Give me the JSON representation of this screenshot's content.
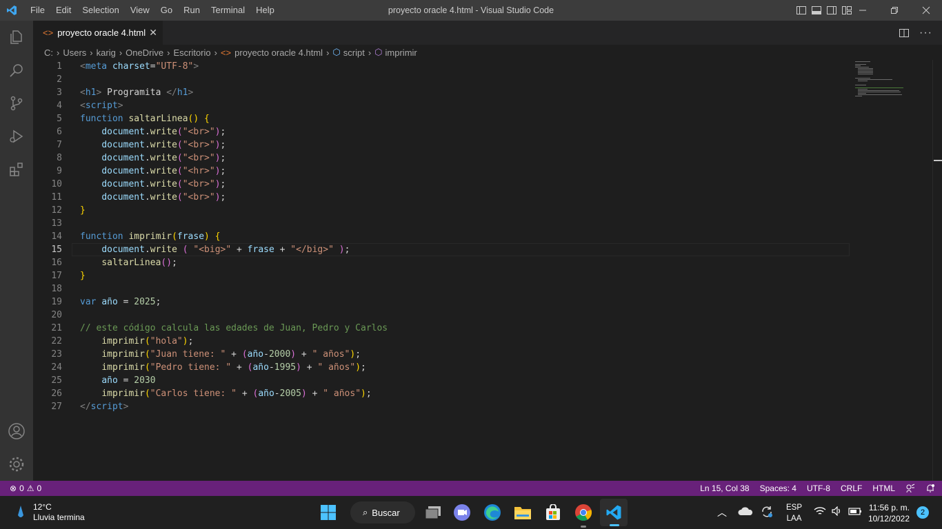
{
  "window": {
    "title": "proyecto oracle 4.html - Visual Studio Code",
    "menu": [
      "File",
      "Edit",
      "Selection",
      "View",
      "Go",
      "Run",
      "Terminal",
      "Help"
    ]
  },
  "tab": {
    "label": "proyecto oracle 4.html"
  },
  "breadcrumb": [
    "C:",
    "Users",
    "karig",
    "OneDrive",
    "Escritorio",
    "proyecto oracle 4.html",
    "script",
    "imprimir"
  ],
  "editor": {
    "current_line": 15,
    "lines": [
      {
        "n": "1"
      },
      {
        "n": "2"
      },
      {
        "n": "3"
      },
      {
        "n": "4"
      },
      {
        "n": "5"
      },
      {
        "n": "6"
      },
      {
        "n": "7"
      },
      {
        "n": "8"
      },
      {
        "n": "9"
      },
      {
        "n": "10"
      },
      {
        "n": "11"
      },
      {
        "n": "12"
      },
      {
        "n": "13"
      },
      {
        "n": "14"
      },
      {
        "n": "15"
      },
      {
        "n": "16"
      },
      {
        "n": "17"
      },
      {
        "n": "18"
      },
      {
        "n": "19"
      },
      {
        "n": "20"
      },
      {
        "n": "21"
      },
      {
        "n": "22"
      },
      {
        "n": "23"
      },
      {
        "n": "24"
      },
      {
        "n": "25"
      },
      {
        "n": "26"
      },
      {
        "n": "27"
      }
    ],
    "code": [
      [
        [
          "tp",
          "<"
        ],
        [
          "tag",
          "meta"
        ],
        [
          "tx",
          " "
        ],
        [
          "attr",
          "charset"
        ],
        [
          "tx",
          "="
        ],
        [
          "str",
          "\"UTF-8\""
        ],
        [
          "tp",
          ">"
        ]
      ],
      [],
      [
        [
          "tp",
          "<"
        ],
        [
          "tag",
          "h1"
        ],
        [
          "tp",
          ">"
        ],
        [
          "tx",
          " Programita "
        ],
        [
          "tp",
          "</"
        ],
        [
          "tag",
          "h1"
        ],
        [
          "tp",
          ">"
        ]
      ],
      [
        [
          "tp",
          "<"
        ],
        [
          "tag",
          "script"
        ],
        [
          "tp",
          ">"
        ]
      ],
      [
        [
          "kw",
          "function"
        ],
        [
          "tx",
          " "
        ],
        [
          "fn",
          "saltarLinea"
        ],
        [
          "br",
          "()"
        ],
        [
          "tx",
          " "
        ],
        [
          "br",
          "{"
        ]
      ],
      [
        [
          "tx",
          "    "
        ],
        [
          "var",
          "document"
        ],
        [
          "tx",
          "."
        ],
        [
          "fn",
          "write"
        ],
        [
          "br2",
          "("
        ],
        [
          "str",
          "\"<br>\""
        ],
        [
          "br2",
          ")"
        ],
        [
          "tx",
          ";"
        ]
      ],
      [
        [
          "tx",
          "    "
        ],
        [
          "var",
          "document"
        ],
        [
          "tx",
          "."
        ],
        [
          "fn",
          "write"
        ],
        [
          "br2",
          "("
        ],
        [
          "str",
          "\"<br>\""
        ],
        [
          "br2",
          ")"
        ],
        [
          "tx",
          ";"
        ]
      ],
      [
        [
          "tx",
          "    "
        ],
        [
          "var",
          "document"
        ],
        [
          "tx",
          "."
        ],
        [
          "fn",
          "write"
        ],
        [
          "br2",
          "("
        ],
        [
          "str",
          "\"<br>\""
        ],
        [
          "br2",
          ")"
        ],
        [
          "tx",
          ";"
        ]
      ],
      [
        [
          "tx",
          "    "
        ],
        [
          "var",
          "document"
        ],
        [
          "tx",
          "."
        ],
        [
          "fn",
          "write"
        ],
        [
          "br2",
          "("
        ],
        [
          "str",
          "\"<hr>\""
        ],
        [
          "br2",
          ")"
        ],
        [
          "tx",
          ";"
        ]
      ],
      [
        [
          "tx",
          "    "
        ],
        [
          "var",
          "document"
        ],
        [
          "tx",
          "."
        ],
        [
          "fn",
          "write"
        ],
        [
          "br2",
          "("
        ],
        [
          "str",
          "\"<br>\""
        ],
        [
          "br2",
          ")"
        ],
        [
          "tx",
          ";"
        ]
      ],
      [
        [
          "tx",
          "    "
        ],
        [
          "var",
          "document"
        ],
        [
          "tx",
          "."
        ],
        [
          "fn",
          "write"
        ],
        [
          "br2",
          "("
        ],
        [
          "str",
          "\"<br>\""
        ],
        [
          "br2",
          ")"
        ],
        [
          "tx",
          ";"
        ]
      ],
      [
        [
          "br",
          "}"
        ]
      ],
      [],
      [
        [
          "kw",
          "function"
        ],
        [
          "tx",
          " "
        ],
        [
          "fn",
          "imprimir"
        ],
        [
          "br",
          "("
        ],
        [
          "var",
          "frase"
        ],
        [
          "br",
          ")"
        ],
        [
          "tx",
          " "
        ],
        [
          "br",
          "{"
        ]
      ],
      [
        [
          "tx",
          "    "
        ],
        [
          "var",
          "document"
        ],
        [
          "tx",
          "."
        ],
        [
          "fn",
          "write"
        ],
        [
          "tx",
          " "
        ],
        [
          "br2",
          "("
        ],
        [
          "tx",
          " "
        ],
        [
          "str",
          "\"<big>\""
        ],
        [
          "tx",
          " + "
        ],
        [
          "var",
          "frase"
        ],
        [
          "tx",
          " + "
        ],
        [
          "str",
          "\"</big>\""
        ],
        [
          "tx",
          " "
        ],
        [
          "br2",
          ")"
        ],
        [
          "tx",
          ";"
        ]
      ],
      [
        [
          "tx",
          "    "
        ],
        [
          "fn",
          "saltarLinea"
        ],
        [
          "br2",
          "()"
        ],
        [
          "tx",
          ";"
        ]
      ],
      [
        [
          "br",
          "}"
        ]
      ],
      [],
      [
        [
          "kw",
          "var"
        ],
        [
          "tx",
          " "
        ],
        [
          "var",
          "año"
        ],
        [
          "tx",
          " = "
        ],
        [
          "num",
          "2025"
        ],
        [
          "tx",
          ";"
        ]
      ],
      [],
      [
        [
          "cm",
          "// este código calcula las edades de Juan, Pedro y Carlos"
        ]
      ],
      [
        [
          "tx",
          "    "
        ],
        [
          "fn",
          "imprimir"
        ],
        [
          "br",
          "("
        ],
        [
          "str",
          "\"hola\""
        ],
        [
          "br",
          ")"
        ],
        [
          "tx",
          ";"
        ]
      ],
      [
        [
          "tx",
          "    "
        ],
        [
          "fn",
          "imprimir"
        ],
        [
          "br",
          "("
        ],
        [
          "str",
          "\"Juan tiene: \""
        ],
        [
          "tx",
          " + "
        ],
        [
          "br2",
          "("
        ],
        [
          "var",
          "año"
        ],
        [
          "tx",
          "-"
        ],
        [
          "num",
          "2000"
        ],
        [
          "br2",
          ")"
        ],
        [
          "tx",
          " + "
        ],
        [
          "str",
          "\" años\""
        ],
        [
          "br",
          ")"
        ],
        [
          "tx",
          ";"
        ]
      ],
      [
        [
          "tx",
          "    "
        ],
        [
          "fn",
          "imprimir"
        ],
        [
          "br",
          "("
        ],
        [
          "str",
          "\"Pedro tiene: \""
        ],
        [
          "tx",
          " + "
        ],
        [
          "br2",
          "("
        ],
        [
          "var",
          "año"
        ],
        [
          "tx",
          "-"
        ],
        [
          "num",
          "1995"
        ],
        [
          "br2",
          ")"
        ],
        [
          "tx",
          " + "
        ],
        [
          "str",
          "\" años\""
        ],
        [
          "br",
          ")"
        ],
        [
          "tx",
          ";"
        ]
      ],
      [
        [
          "tx",
          "    "
        ],
        [
          "var",
          "año"
        ],
        [
          "tx",
          " = "
        ],
        [
          "num",
          "2030"
        ]
      ],
      [
        [
          "tx",
          "    "
        ],
        [
          "fn",
          "imprimir"
        ],
        [
          "br",
          "("
        ],
        [
          "str",
          "\"Carlos tiene: \""
        ],
        [
          "tx",
          " + "
        ],
        [
          "br2",
          "("
        ],
        [
          "var",
          "año"
        ],
        [
          "tx",
          "-"
        ],
        [
          "num",
          "2005"
        ],
        [
          "br2",
          ")"
        ],
        [
          "tx",
          " + "
        ],
        [
          "str",
          "\" años\""
        ],
        [
          "br",
          ")"
        ],
        [
          "tx",
          ";"
        ]
      ],
      [
        [
          "tp",
          "</"
        ],
        [
          "tag",
          "script"
        ],
        [
          "tp",
          ">"
        ]
      ]
    ]
  },
  "status": {
    "errors": "0",
    "warnings": "0",
    "position": "Ln 15, Col 38",
    "spaces": "Spaces: 4",
    "encoding": "UTF-8",
    "eol": "CRLF",
    "language": "HTML"
  },
  "taskbar": {
    "weather_temp": "12°C",
    "weather_desc": "Lluvia termina",
    "search_label": "Buscar",
    "lang_top": "ESP",
    "lang_bottom": "LAA",
    "time": "11:56 p. m.",
    "date": "10/12/2022",
    "notification_count": "2"
  },
  "colors": {
    "statusbar": "#68217a",
    "titlebar": "#3c3c3c",
    "activitybar": "#333333",
    "editor_bg": "#1e1e1e"
  }
}
